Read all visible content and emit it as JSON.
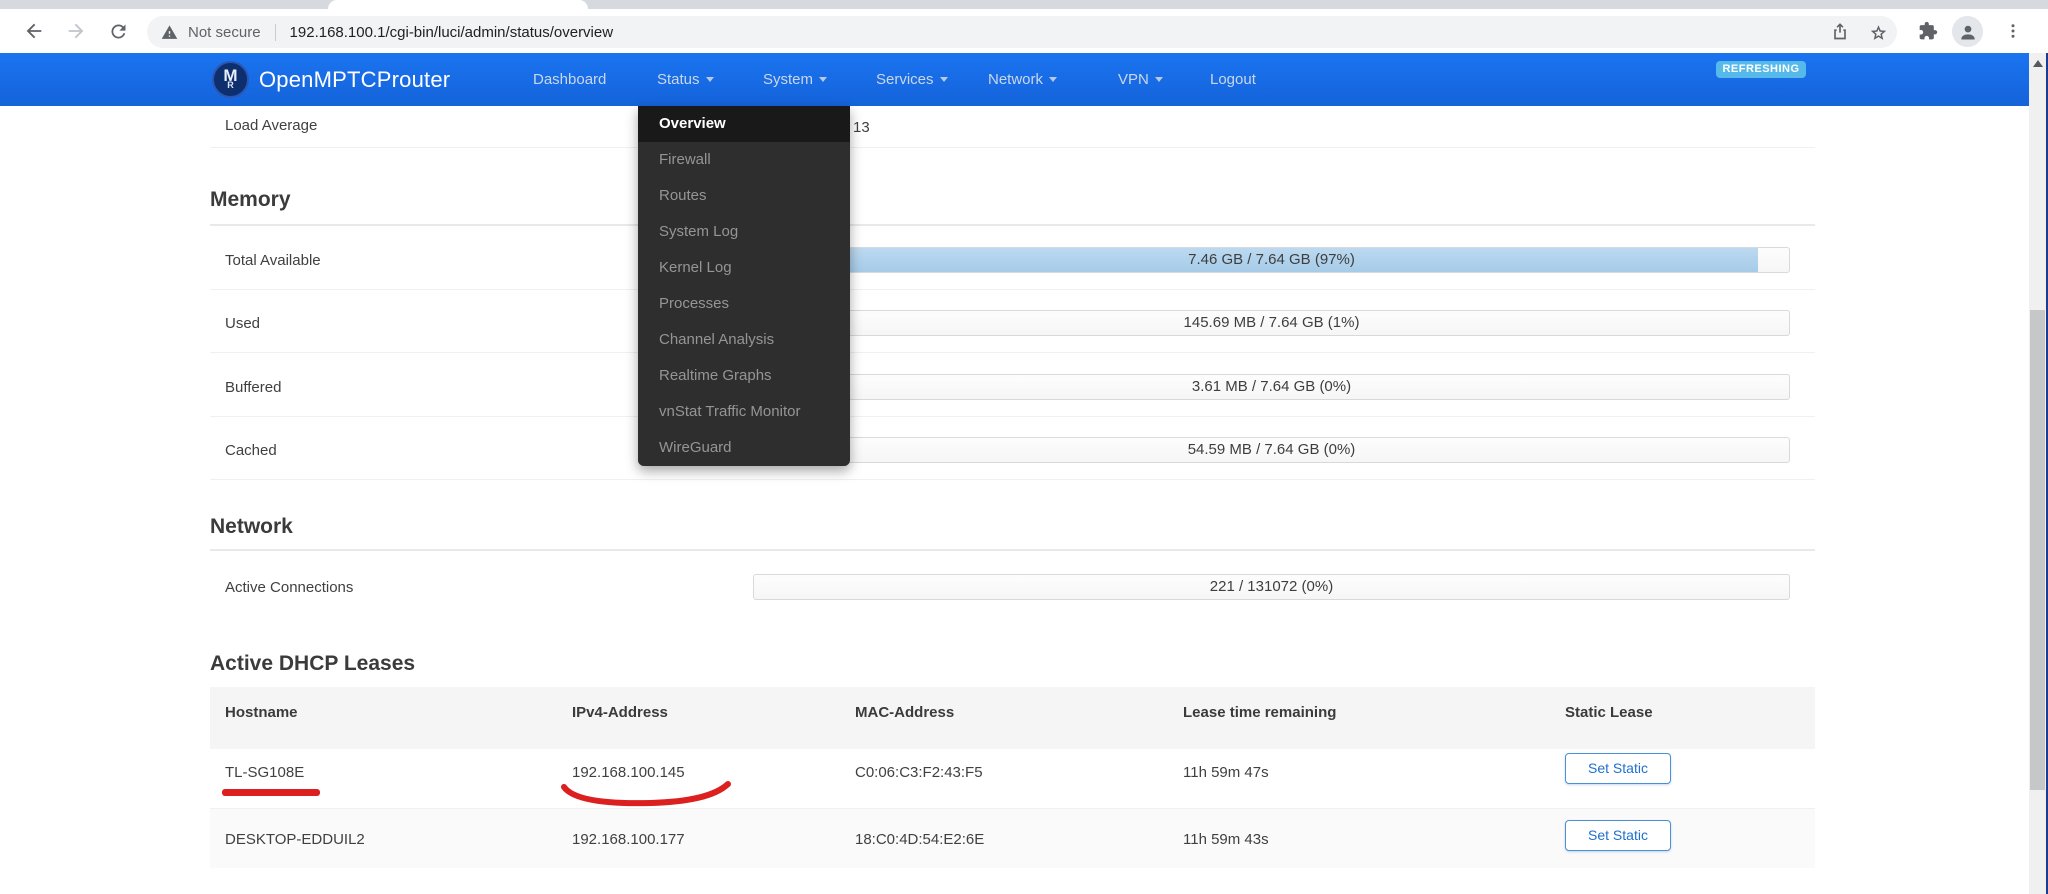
{
  "browser": {
    "security_label": "Not secure",
    "url": "192.168.100.1/cgi-bin/luci/admin/status/overview"
  },
  "navbar": {
    "brand": "OpenMPTCProuter",
    "logo_letter_main": "M",
    "logo_letter_sub": "R",
    "items": [
      {
        "label": "Dashboard"
      },
      {
        "label": "Status"
      },
      {
        "label": "System"
      },
      {
        "label": "Services"
      },
      {
        "label": "Network"
      },
      {
        "label": "VPN"
      },
      {
        "label": "Logout"
      }
    ],
    "refreshing_badge": "REFRESHING",
    "colors": {
      "bar": "#1769e6",
      "badge_bg": "#55b9ea"
    }
  },
  "dropdown": {
    "items": [
      {
        "label": "Overview",
        "active": true
      },
      {
        "label": "Firewall",
        "active": false
      },
      {
        "label": "Routes",
        "active": false
      },
      {
        "label": "System Log",
        "active": false
      },
      {
        "label": "Kernel Log",
        "active": false
      },
      {
        "label": "Processes",
        "active": false
      },
      {
        "label": "Channel Analysis",
        "active": false
      },
      {
        "label": "Realtime Graphs",
        "active": false
      },
      {
        "label": "vnStat Traffic Monitor",
        "active": false
      },
      {
        "label": "WireGuard",
        "active": false
      }
    ]
  },
  "page": {
    "load_average": {
      "label": "Load Average",
      "visible_value": "13"
    },
    "memory": {
      "heading": "Memory",
      "rows": [
        {
          "label": "Total Available",
          "value": "7.46 GB / 7.64 GB (97%)",
          "percent": 97
        },
        {
          "label": "Used",
          "value": "145.69 MB / 7.64 GB (1%)",
          "percent": 1
        },
        {
          "label": "Buffered",
          "value": "3.61 MB / 7.64 GB (0%)",
          "percent": 0
        },
        {
          "label": "Cached",
          "value": "54.59 MB / 7.64 GB (0%)",
          "percent": 0
        }
      ]
    },
    "network": {
      "heading": "Network",
      "rows": [
        {
          "label": "Active Connections",
          "value": "221 / 131072 (0%)",
          "percent": 0
        }
      ]
    },
    "dhcp": {
      "heading": "Active DHCP Leases",
      "columns": [
        "Hostname",
        "IPv4-Address",
        "MAC-Address",
        "Lease time remaining",
        "Static Lease"
      ],
      "button_label": "Set Static",
      "rows": [
        {
          "hostname": "TL-SG108E",
          "ip": "192.168.100.145",
          "mac": "C0:06:C3:F2:43:F5",
          "lease": "11h 59m 47s"
        },
        {
          "hostname": "DESKTOP-EDDUIL2",
          "ip": "192.168.100.177",
          "mac": "18:C0:4D:54:E2:6E",
          "lease": "11h 59m 43s"
        }
      ]
    },
    "annotation_color": "#dc1f1f"
  }
}
